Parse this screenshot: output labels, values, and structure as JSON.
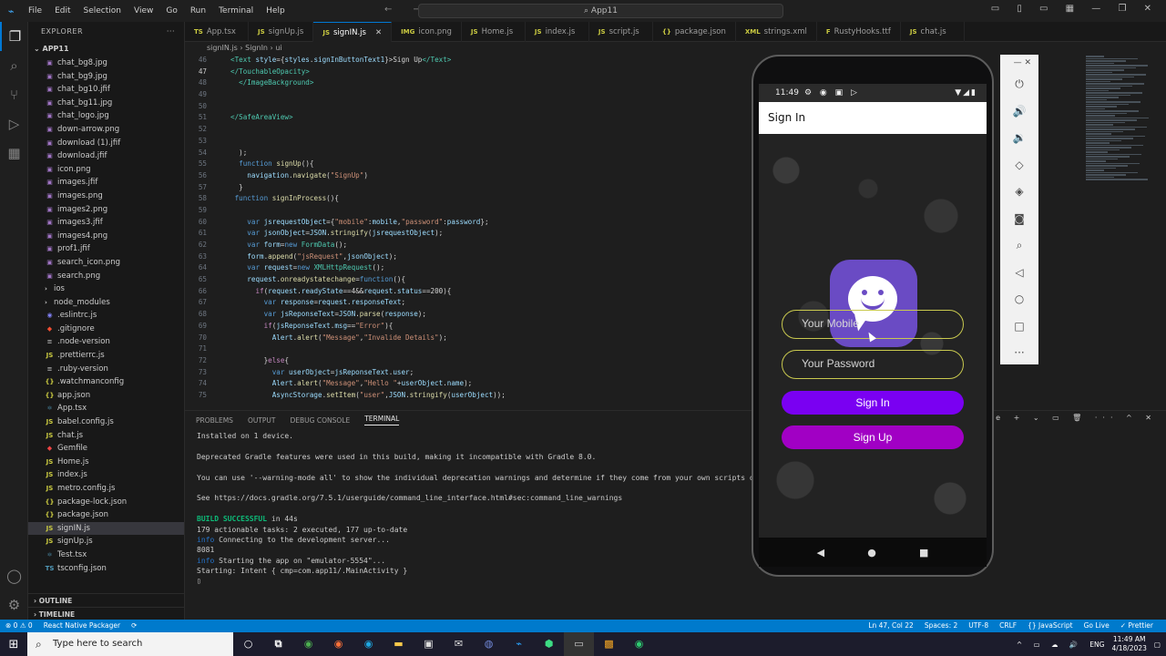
{
  "title_bar": {
    "menu": [
      "File",
      "Edit",
      "Selection",
      "View",
      "Go",
      "Run",
      "Terminal",
      "Help"
    ],
    "command_center": "App11"
  },
  "sidebar": {
    "header": "EXPLORER",
    "project": "APP11",
    "files": [
      {
        "name": "chat_bg8.jpg",
        "icon": "image"
      },
      {
        "name": "chat_bg9.jpg",
        "icon": "image"
      },
      {
        "name": "chat_bg10.jfif",
        "icon": "image"
      },
      {
        "name": "chat_bg11.jpg",
        "icon": "image"
      },
      {
        "name": "chat_logo.jpg",
        "icon": "image"
      },
      {
        "name": "down-arrow.png",
        "icon": "image"
      },
      {
        "name": "download (1).jfif",
        "icon": "image"
      },
      {
        "name": "download.jfif",
        "icon": "image"
      },
      {
        "name": "icon.png",
        "icon": "image"
      },
      {
        "name": "images.jfif",
        "icon": "image"
      },
      {
        "name": "images.png",
        "icon": "image"
      },
      {
        "name": "images2.png",
        "icon": "image"
      },
      {
        "name": "images3.jfif",
        "icon": "image"
      },
      {
        "name": "images4.png",
        "icon": "image"
      },
      {
        "name": "prof1.jfif",
        "icon": "image"
      },
      {
        "name": "search_icon.png",
        "icon": "image"
      },
      {
        "name": "search.png",
        "icon": "image"
      },
      {
        "name": "ios",
        "icon": "folder"
      },
      {
        "name": "node_modules",
        "icon": "folder"
      },
      {
        "name": ".eslintrc.js",
        "icon": "eslint"
      },
      {
        "name": ".gitignore",
        "icon": "git"
      },
      {
        "name": ".node-version",
        "icon": "text"
      },
      {
        "name": ".prettierrc.js",
        "icon": "js"
      },
      {
        "name": ".ruby-version",
        "icon": "text"
      },
      {
        "name": ".watchmanconfig",
        "icon": "json"
      },
      {
        "name": "app.json",
        "icon": "json"
      },
      {
        "name": "App.tsx",
        "icon": "tsx"
      },
      {
        "name": "babel.config.js",
        "icon": "js"
      },
      {
        "name": "chat.js",
        "icon": "js"
      },
      {
        "name": "Gemfile",
        "icon": "ruby"
      },
      {
        "name": "Home.js",
        "icon": "js"
      },
      {
        "name": "index.js",
        "icon": "js"
      },
      {
        "name": "metro.config.js",
        "icon": "js"
      },
      {
        "name": "package-lock.json",
        "icon": "json"
      },
      {
        "name": "package.json",
        "icon": "json"
      },
      {
        "name": "signIN.js",
        "icon": "js",
        "selected": true
      },
      {
        "name": "signUp.js",
        "icon": "js"
      },
      {
        "name": "Test.tsx",
        "icon": "tsx"
      },
      {
        "name": "tsconfig.json",
        "icon": "ts"
      }
    ],
    "outline_label": "OUTLINE",
    "timeline_label": "TIMELINE"
  },
  "tabs": [
    {
      "label": "App.tsx",
      "icon": "TS"
    },
    {
      "label": "signUp.js",
      "icon": "JS"
    },
    {
      "label": "signIN.js",
      "icon": "JS",
      "active": true
    },
    {
      "label": "icon.png",
      "icon": "IMG"
    },
    {
      "label": "Home.js",
      "icon": "JS"
    },
    {
      "label": "index.js",
      "icon": "JS"
    },
    {
      "label": "script.js",
      "icon": "JS"
    },
    {
      "label": "package.json",
      "icon": "{}"
    },
    {
      "label": "strings.xml",
      "icon": "XML"
    },
    {
      "label": "RustyHooks.ttf",
      "icon": "F"
    },
    {
      "label": "chat.js",
      "icon": "JS"
    }
  ],
  "breadcrumb": {
    "file": "signIN.js",
    "symbol": "SignIn",
    "sub": "ui"
  },
  "editor": {
    "lines": [
      {
        "n": "46",
        "html": "<span class='t'>&lt;Text</span> <span class='v'>style</span>={<span class='v'>styles</span>.<span class='v'>signInButtonText1</span>}&gt;Sign Up<span class='t'>&lt;/Text&gt;</span>"
      },
      {
        "n": "47",
        "html": "<span class='t'>&lt;/TouchableOpacity&gt;</span>",
        "cur": true
      },
      {
        "n": "48",
        "html": "  <span class='t'>&lt;/ImageBackground&gt;</span>"
      },
      {
        "n": "49",
        "html": ""
      },
      {
        "n": "50",
        "html": ""
      },
      {
        "n": "51",
        "html": "<span class='t'>&lt;/SafeAreaView&gt;</span>"
      },
      {
        "n": "52",
        "html": ""
      },
      {
        "n": "53",
        "html": ""
      },
      {
        "n": "54",
        "html": "  );"
      },
      {
        "n": "55",
        "html": "  <span class='k'>function</span> <span class='f'>signUp</span>(){"
      },
      {
        "n": "56",
        "html": "    <span class='v'>navigation</span>.<span class='f'>navigate</span>(<span class='s'>\"SignUp\"</span>)"
      },
      {
        "n": "57",
        "html": "  }"
      },
      {
        "n": "58",
        "html": " <span class='k'>function</span> <span class='f'>signInProcess</span>(){"
      },
      {
        "n": "59",
        "html": ""
      },
      {
        "n": "60",
        "html": "    <span class='k'>var</span> <span class='v'>jsrequestObject</span>={<span class='s'>\"mobile\"</span>:<span class='v'>mobile</span>,<span class='s'>\"password\"</span>:<span class='v'>password</span>};"
      },
      {
        "n": "61",
        "html": "    <span class='k'>var</span> <span class='v'>jsonObject</span>=<span class='v'>JSON</span>.<span class='f'>stringify</span>(<span class='v'>jsrequestObject</span>);"
      },
      {
        "n": "62",
        "html": "    <span class='k'>var</span> <span class='v'>form</span>=<span class='k'>new</span> <span class='t'>FormData</span>();"
      },
      {
        "n": "63",
        "html": "    <span class='v'>form</span>.<span class='f'>append</span>(<span class='s'>\"jsRequest\"</span>,<span class='v'>jsonObject</span>);"
      },
      {
        "n": "64",
        "html": "    <span class='k'>var</span> <span class='v'>request</span>=<span class='k'>new</span> <span class='t'>XMLHttpRequest</span>();"
      },
      {
        "n": "65",
        "html": "    <span class='v'>request</span>.<span class='f'>onreadystatechange</span>=<span class='k'>function</span>(){"
      },
      {
        "n": "66",
        "html": "      <span class='p'>if</span>(<span class='v'>request</span>.<span class='v'>readyState</span>==4&amp;&amp;<span class='v'>request</span>.<span class='v'>status</span>==200){"
      },
      {
        "n": "67",
        "html": "        <span class='k'>var</span> <span class='v'>response</span>=<span class='v'>request</span>.<span class='v'>responseText</span>;"
      },
      {
        "n": "68",
        "html": "        <span class='k'>var</span> <span class='v'>jsReponseText</span>=<span class='v'>JSON</span>.<span class='f'>parse</span>(<span class='v'>response</span>);"
      },
      {
        "n": "69",
        "html": "        <span class='p'>if</span>(<span class='v'>jsReponseText</span>.<span class='v'>msg</span>==<span class='s'>\"Error\"</span>){"
      },
      {
        "n": "70",
        "html": "          <span class='v'>Alert</span>.<span class='f'>alert</span>(<span class='s'>\"Message\"</span>,<span class='s'>\"Invalide Details\"</span>);"
      },
      {
        "n": "71",
        "html": ""
      },
      {
        "n": "72",
        "html": "        }<span class='p'>else</span>{"
      },
      {
        "n": "73",
        "html": "          <span class='k'>var</span> <span class='v'>userObject</span>=<span class='v'>jsReponseText</span>.<span class='v'>user</span>;"
      },
      {
        "n": "74",
        "html": "          <span class='v'>Alert</span>.<span class='f'>alert</span>(<span class='s'>\"Message\"</span>,<span class='s'>\"Hello \"</span>+<span class='v'>userObject</span>.<span class='v'>name</span>);"
      },
      {
        "n": "75",
        "html": "          <span class='v'>AsyncStorage</span>.<span class='f'>setItem</span>(<span class='s'>\"user\"</span>,<span class='v'>JSON</span>.<span class='f'>stringify</span>(<span class='v'>userObject</span>));"
      }
    ]
  },
  "panel": {
    "tabs": [
      "PROBLEMS",
      "OUTPUT",
      "DEBUG CONSOLE",
      "TERMINAL"
    ],
    "active_tab": "TERMINAL",
    "shell_label": "node",
    "terminal_lines": [
      {
        "text": "Installed on 1 device."
      },
      {
        "text": ""
      },
      {
        "text": "Deprecated Gradle features were used in this build, making it incompatible with Gradle 8.0."
      },
      {
        "text": ""
      },
      {
        "text": "You can use '--warning-mode all' to show the individual deprecation warnings and determine if they come from your own scripts or p"
      },
      {
        "text": ""
      },
      {
        "text": "See https://docs.gradle.org/7.5.1/userguide/command_line_interface.html#sec:command_line_warnings"
      },
      {
        "text": ""
      },
      {
        "text": "BUILD SUCCESSFUL",
        "suffix": " in 44s",
        "style": "bl"
      },
      {
        "text": "179 actionable tasks: 2 executed, 177 up-to-date"
      },
      {
        "text": "info",
        "suffix": " Connecting to the development server...",
        "style": "cy"
      },
      {
        "text": "8081"
      },
      {
        "text": "info",
        "suffix": " Starting the app on \"emulator-5554\"...",
        "style": "cy"
      },
      {
        "text": "Starting: Intent { cmp=com.app11/.MainActivity }"
      },
      {
        "text": "▯"
      }
    ]
  },
  "statusbar": {
    "left": [
      "⊗ 0  ⚠ 0",
      "React Native Packager",
      "⟳"
    ],
    "right": [
      "Ln 47, Col 22",
      "Spaces: 2",
      "UTF-8",
      "CRLF",
      "{} JavaScript",
      "Go Live",
      "✓ Prettier"
    ]
  },
  "phone": {
    "time": "11:49",
    "appbar_title": "Sign In",
    "mobile_placeholder": "Your Mobile",
    "password_placeholder": "Your Password",
    "signin_label": "Sign In",
    "signup_label": "Sign Up",
    "colors": {
      "signin": "#7a00f2",
      "signup": "#a100c4",
      "logo": "#6a4bc4",
      "field_border": "#c9c94f"
    }
  },
  "taskbar": {
    "search_placeholder": "Type here to search",
    "lang": "ENG",
    "time": "11:49 AM",
    "date": "4/18/2023"
  }
}
